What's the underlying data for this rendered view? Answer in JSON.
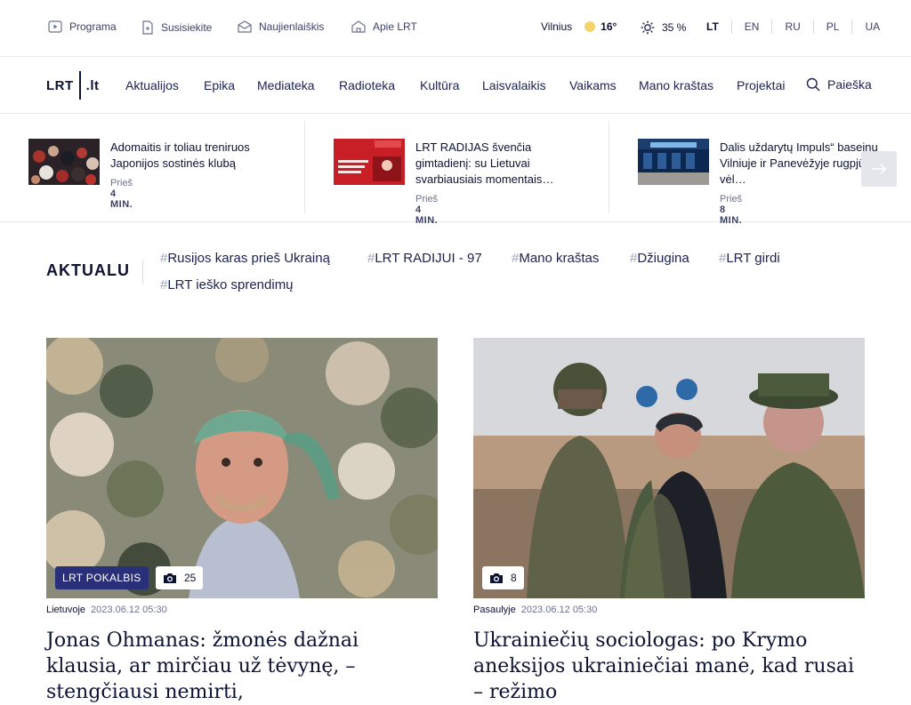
{
  "utility": {
    "items": [
      {
        "label": "Programa",
        "icon": "play-icon"
      },
      {
        "label": "Susisiekite",
        "icon": "document-icon"
      },
      {
        "label": "Naujienlaiškis",
        "icon": "envelope-icon"
      },
      {
        "label": "Apie LRT",
        "icon": "home-icon"
      }
    ],
    "city": "Vilnius",
    "temperature": "16°",
    "humidity": "35 %",
    "languages": [
      "LT",
      "EN",
      "RU",
      "PL",
      "UA"
    ],
    "active_language": "LT"
  },
  "logo": {
    "left": "LRT",
    "right": ".lt"
  },
  "nav": {
    "items": [
      "Aktualijos",
      "Epika",
      "Mediateka",
      "Radioteka",
      "Kultūra",
      "Laisvalaikis",
      "Vaikams",
      "Mano kraštas",
      "Projektai"
    ],
    "search_label": "Paieška"
  },
  "ticker": {
    "items": [
      {
        "title": "Adomaitis ir toliau treniruos Japonijos sostinės klubą",
        "time_prefix": "Prieš",
        "time_value": "4 MIN."
      },
      {
        "title": "LRT RADIJAS švenčia gimtadienį: su Lietuvai svarbiausiais momentais…",
        "time_prefix": "Prieš",
        "time_value": "4 MIN."
      },
      {
        "title": "Dalis uždarytų Impuls“ baseinų Vilniuje ir Panevėžyje rugpjūtį vėl…",
        "time_prefix": "Prieš",
        "time_value": "8 MIN."
      }
    ]
  },
  "aktualu": {
    "label": "AKTUALU",
    "tags": [
      "Rusijos karas prieš Ukrainą",
      "LRT RADIJUI - 97",
      "Mano kraštas",
      "Džiugina",
      "LRT girdi",
      "LRT ieško sprendimų"
    ]
  },
  "articles": [
    {
      "badge": "LRT POKALBIS",
      "photos": "25",
      "category": "Lietuvoje",
      "date": "2023.06.12 05:30",
      "headline": "Jonas Ohmanas: žmonės dažnai klausia, ar mirčiau už tėvynę, – stengčiausi nemirti,"
    },
    {
      "photos": "8",
      "category": "Pasaulyje",
      "date": "2023.06.12 05:30",
      "headline": "Ukrainiečių sociologas: po Krymo aneksijos ukrainiečiai manė, kad rusai – režimo"
    }
  ],
  "colors": {
    "accent": "#2a2f7a",
    "text": "#0b1234",
    "sun": "#f5d36b"
  }
}
